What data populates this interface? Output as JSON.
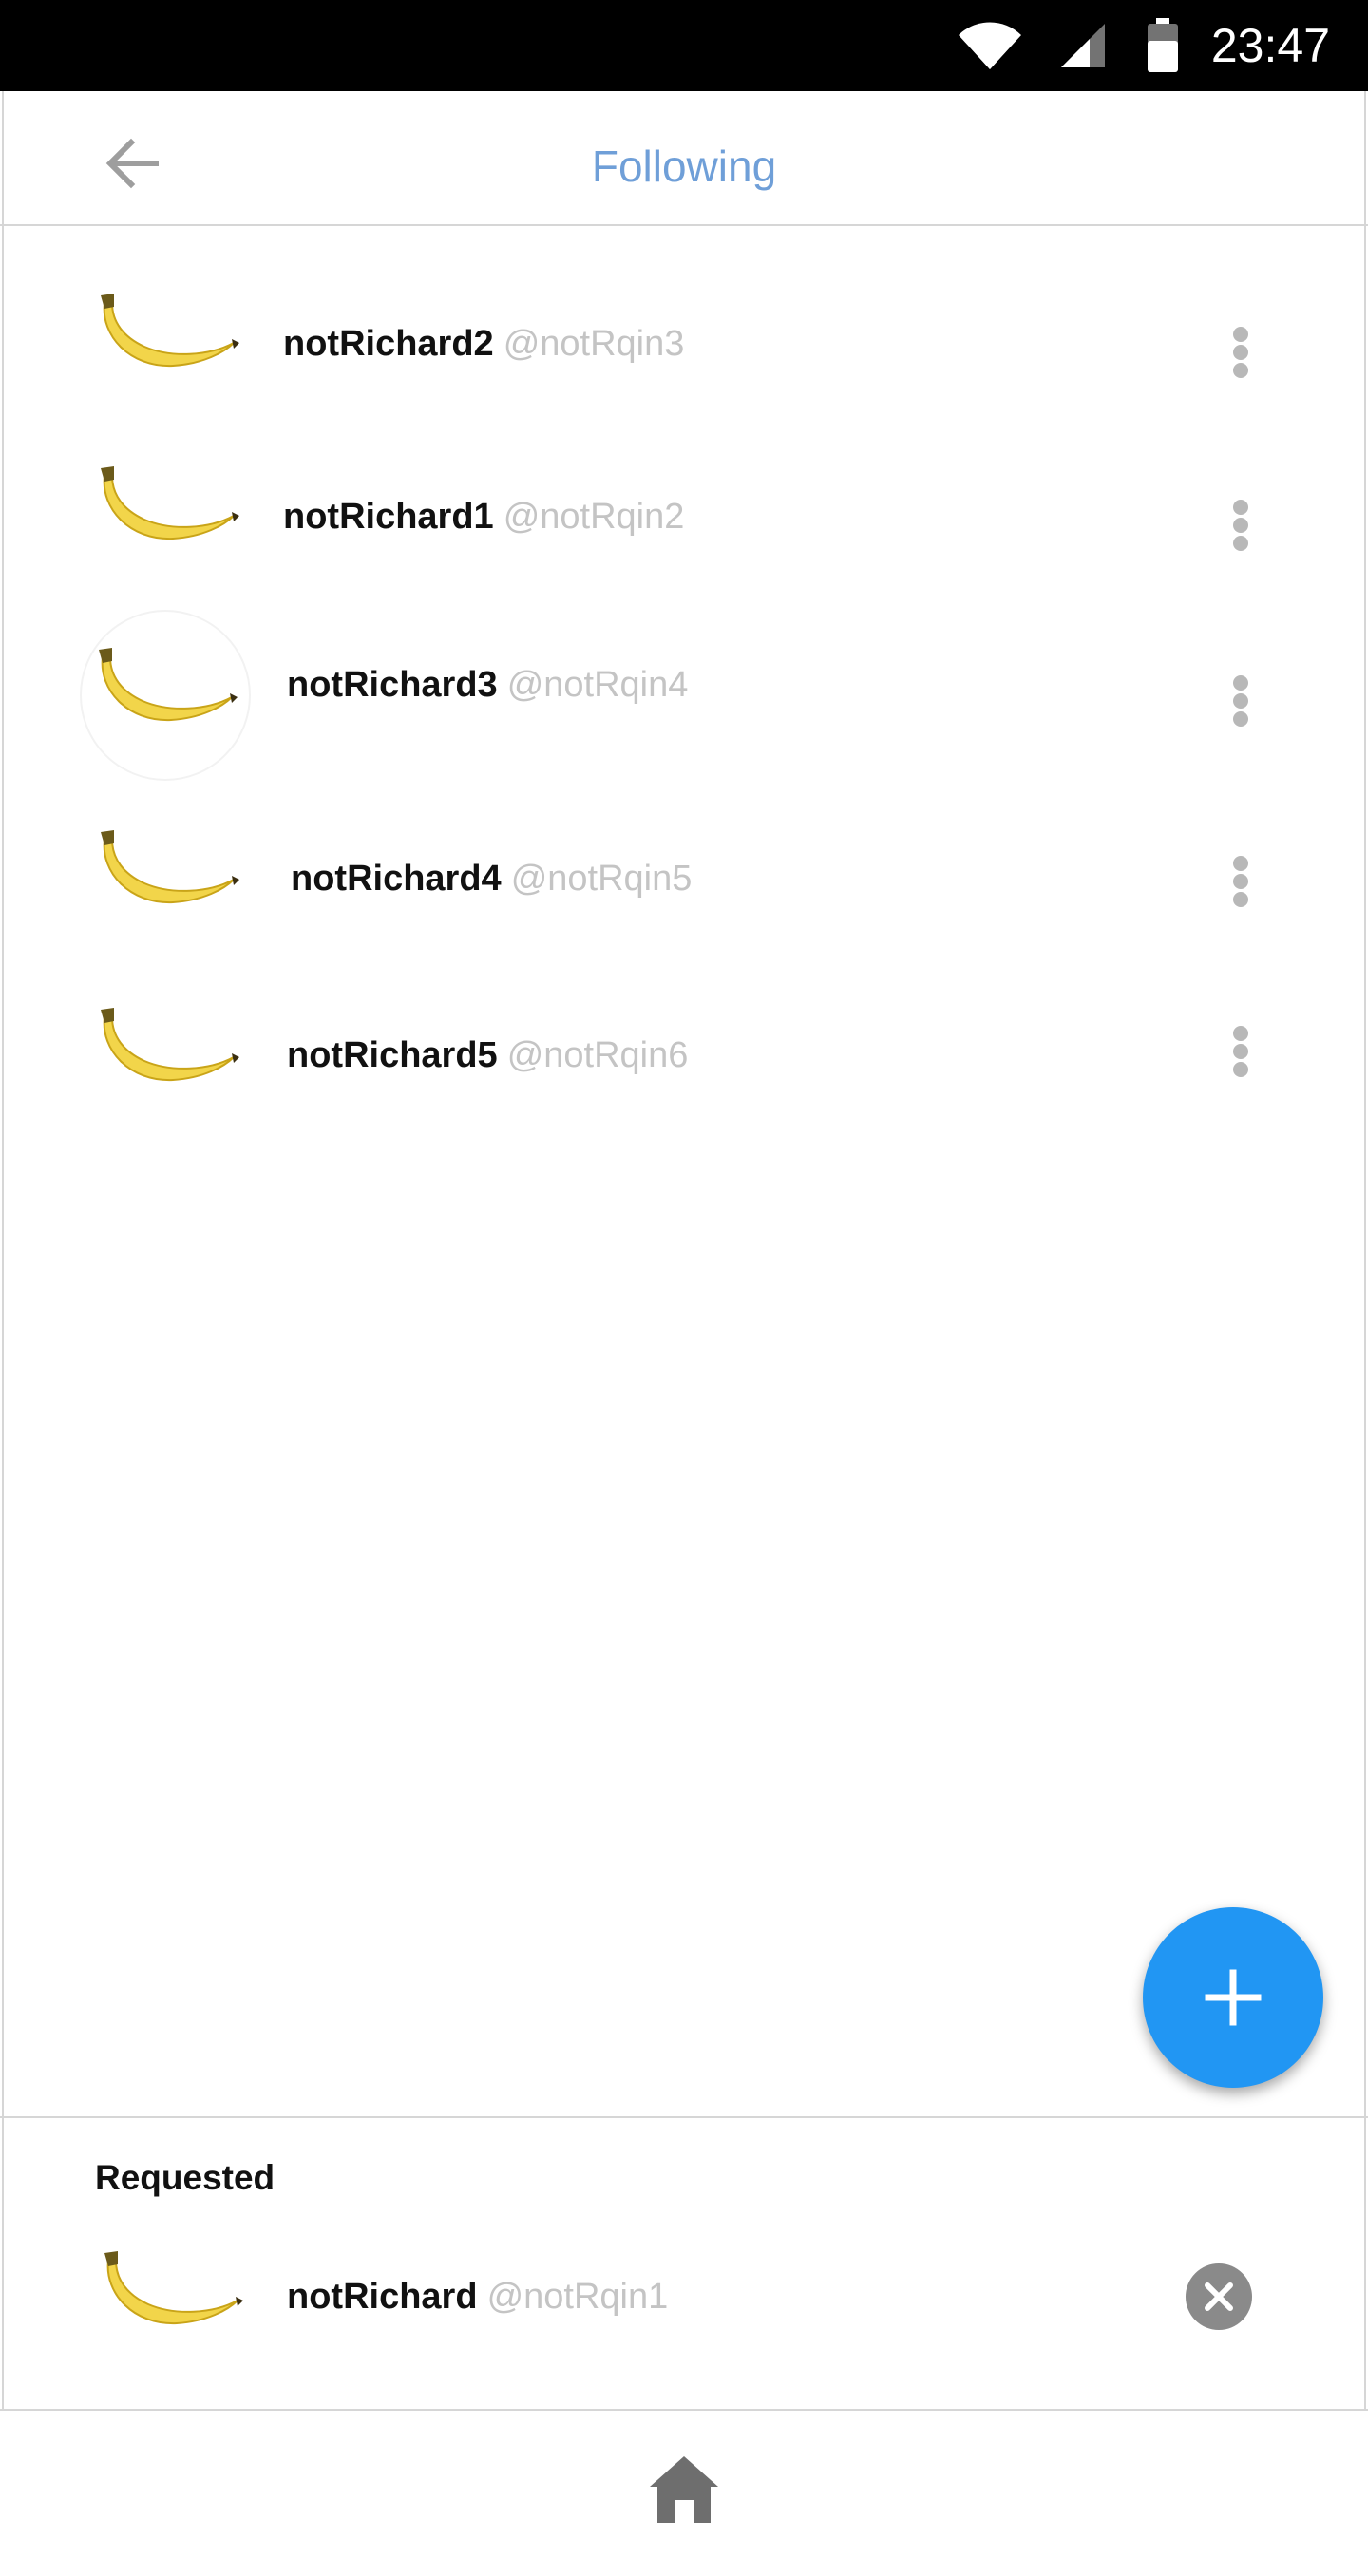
{
  "status_bar": {
    "time": "23:47",
    "icons": [
      "wifi-icon",
      "cell-signal-icon",
      "battery-icon"
    ]
  },
  "header": {
    "title": "Following",
    "back_icon": "arrow-left-icon"
  },
  "following": [
    {
      "name": "notRichard2",
      "handle": "@notRqin3",
      "avatar_icon": "banana-icon",
      "menu_icon": "more-vertical-icon"
    },
    {
      "name": "notRichard1",
      "handle": "@notRqin2",
      "avatar_icon": "banana-icon",
      "menu_icon": "more-vertical-icon"
    },
    {
      "name": "notRichard3",
      "handle": "@notRqin4",
      "avatar_icon": "banana-icon",
      "menu_icon": "more-vertical-icon"
    },
    {
      "name": "notRichard4",
      "handle": "@notRqin5",
      "avatar_icon": "banana-icon",
      "menu_icon": "more-vertical-icon"
    },
    {
      "name": "notRichard5",
      "handle": "@notRqin6",
      "avatar_icon": "banana-icon",
      "menu_icon": "more-vertical-icon"
    }
  ],
  "fab": {
    "icon": "plus-icon"
  },
  "requested": {
    "title": "Requested",
    "items": [
      {
        "name": "notRichard",
        "handle": "@notRqin1",
        "avatar_icon": "banana-icon",
        "action_icon": "close-circle-icon"
      }
    ]
  },
  "bottom_nav": {
    "icon": "home-icon"
  },
  "colors": {
    "accent": "#2196f3",
    "title": "#6f9fd8",
    "handle": "#c4c4c4",
    "divider": "#d6d6d6"
  }
}
